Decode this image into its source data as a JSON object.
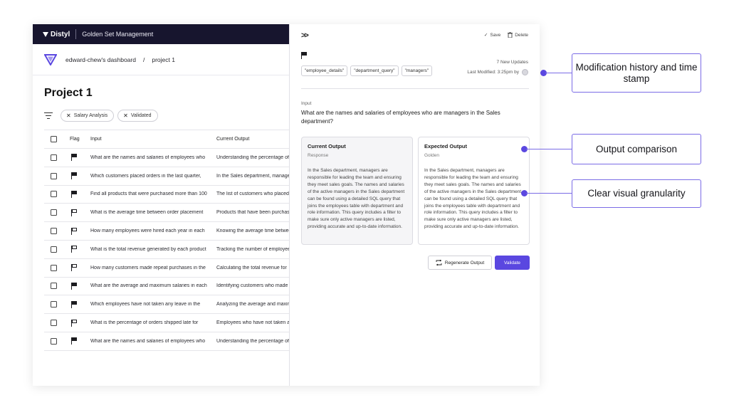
{
  "topbar": {
    "brand": "Distyl",
    "title": "Golden Set Management"
  },
  "breadcrumb": {
    "dashboard": "edward-chew's dashboard",
    "separator": "/",
    "project": "project 1"
  },
  "page": {
    "title": "Project 1"
  },
  "filters": [
    {
      "label": "Salary Analysis"
    },
    {
      "label": "Validated"
    }
  ],
  "table": {
    "headers": {
      "flag": "Flag",
      "input": "Input",
      "output": "Current Output"
    },
    "rows": [
      {
        "flag": "filled",
        "input": "What are the names and salaries of employees who",
        "output": "Understanding the percentage of"
      },
      {
        "flag": "filled",
        "input": "Which customers placed orders in the last quarter,",
        "output": "In the Sales department, managers"
      },
      {
        "flag": "filled",
        "input": "Find all products that were purchased more than 100",
        "output": "The list of customers who placed"
      },
      {
        "flag": "outline",
        "input": "What is the average time between order placement",
        "output": "Products that have been purchased"
      },
      {
        "flag": "outline",
        "input": "How many employees were hired each year in each",
        "output": "Knowing the average time between"
      },
      {
        "flag": "outline",
        "input": "What is the total revenue generated by each product",
        "output": "Tracking the number of employees"
      },
      {
        "flag": "outline",
        "input": "How many customers made repeat purchases in the",
        "output": "Calculating the total revenue for"
      },
      {
        "flag": "filled",
        "input": "What are the average and maximum salaries in each",
        "output": "Identifying customers who made"
      },
      {
        "flag": "filled",
        "input": "Which employees have not taken any leave in the",
        "output": "Analyzing the average and maximum"
      },
      {
        "flag": "outline",
        "input": "What is the percentage of orders shipped late for",
        "output": "Employees who have not taken any"
      },
      {
        "flag": "filled",
        "input": "What are the names and salaries of employees who",
        "output": "Understanding the percentage of"
      }
    ]
  },
  "panel": {
    "save_label": "Save",
    "delete_label": "Delete",
    "updates": "7 New Updates",
    "tags": [
      "\"employee_details\"",
      "\"department_query\"",
      "\"managers\""
    ],
    "last_modified": "Last Modified: 3:25pm by",
    "input_label": "Input",
    "input_text": "What are the names and salaries of employees who are managers in the Sales department?",
    "current": {
      "title": "Current Output",
      "subtitle": "Response",
      "body": "In the Sales department, managers are responsible for leading the team and ensuring they meet sales goals. The names and salaries of the active managers in the Sales department can be found using a detailed SQL query that joins the employees table with department and role information. This query includes a filter to make sure only active managers are listed, providing accurate and up-to-date information."
    },
    "expected": {
      "title": "Expected Output",
      "subtitle": "Golden",
      "body": "In the Sales department, managers are responsible for leading the team and ensuring they meet sales goals. The names and salaries of the active managers in the Sales department can be found using a detailed SQL query that joins the employees table with department and role information. This query includes a filter to make sure only active managers are listed, providing accurate and up-to-date information."
    },
    "regenerate_label": "Regenerate Output",
    "validate_label": "Validate"
  },
  "annotations": {
    "history": "Modification history and time stamp",
    "comparison": "Output comparison",
    "granularity": "Clear visual granularity"
  },
  "colors": {
    "accent": "#5a47e0",
    "topbar": "#17152e"
  }
}
